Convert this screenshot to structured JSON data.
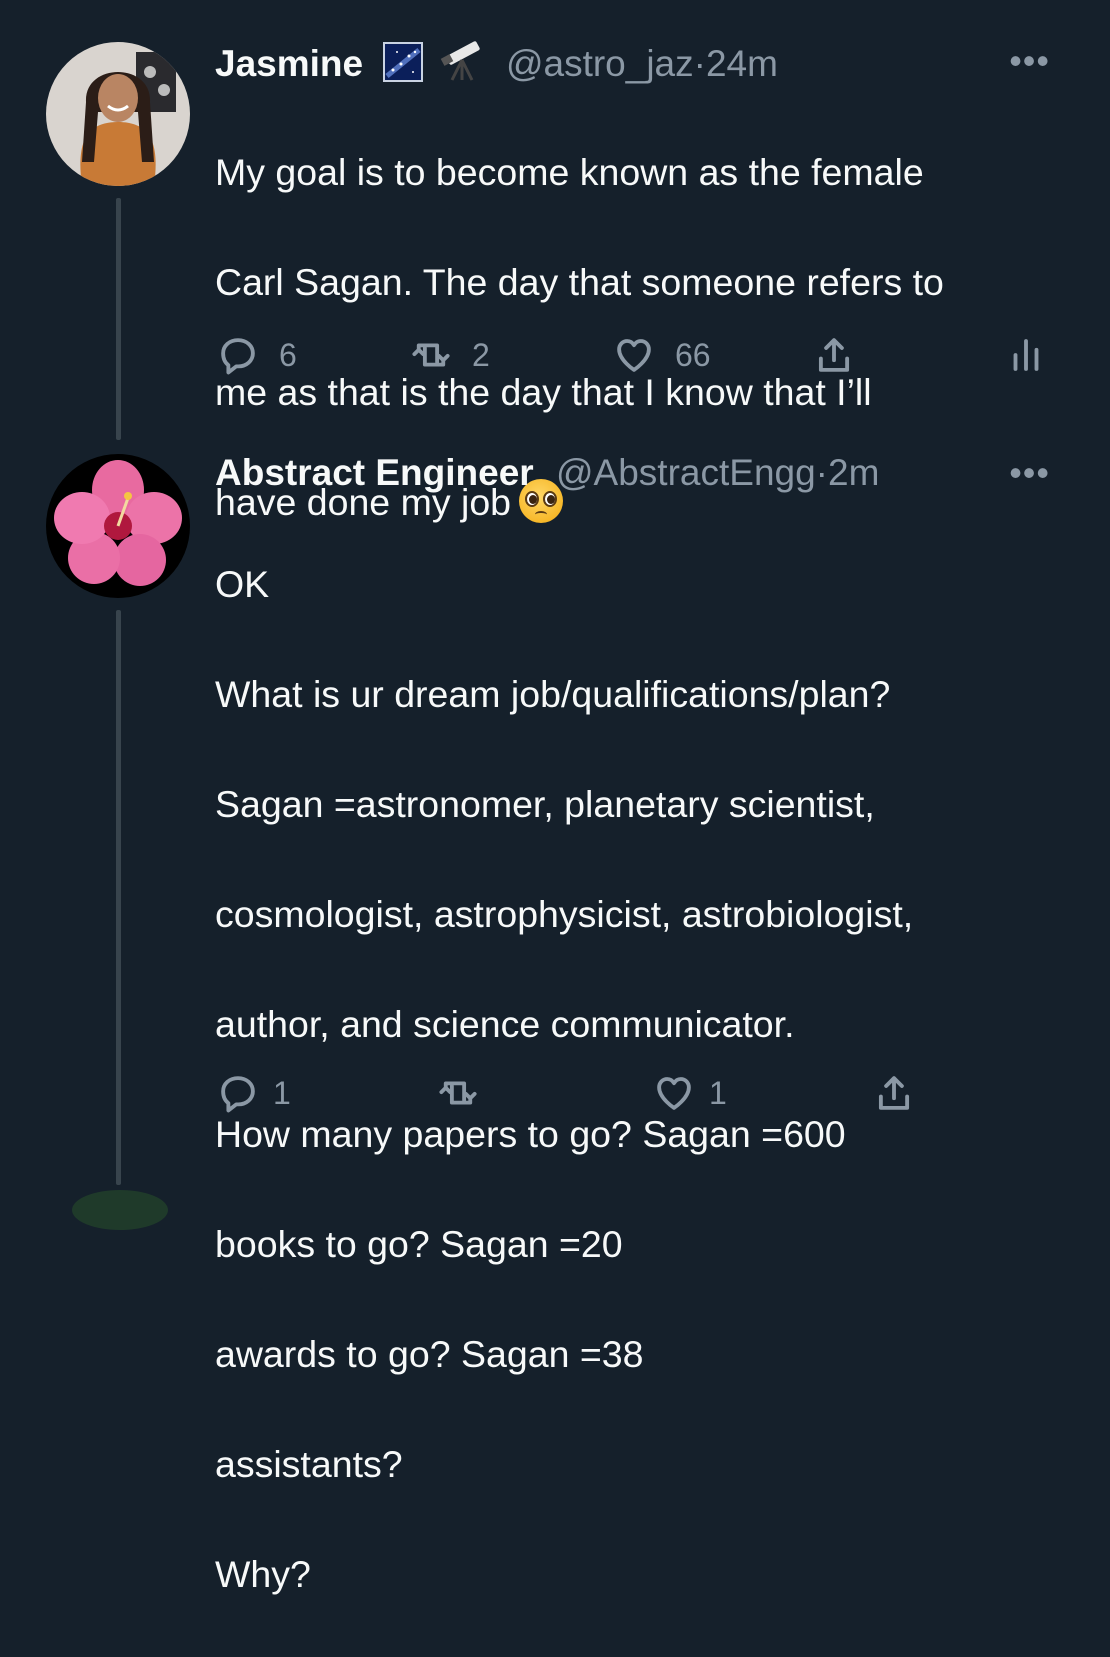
{
  "tweets": [
    {
      "name": "Jasmine",
      "badges": [
        "milky-way-emoji",
        "telescope-emoji"
      ],
      "handle": "@astro_jaz",
      "dot": "·",
      "time": "24m",
      "more": "•••",
      "lines": [
        "My goal is to become known as the female",
        "Carl Sagan. The day that someone refers to",
        "me as that is the day that I know that I’ll",
        "have done my job"
      ],
      "trailing_emoji": "pleading-face-emoji",
      "actions": {
        "replies": "6",
        "retweets": "2",
        "likes": "66"
      }
    },
    {
      "name": "Abstract Engineer",
      "handle": "@AbstractEngg",
      "dot": "·",
      "time": "2m",
      "more": "•••",
      "lines": [
        "OK",
        "What is ur dream job/qualifications/plan?",
        "Sagan =astronomer, planetary scientist,",
        "cosmologist, astrophysicist, astrobiologist,",
        "author, and science communicator.",
        "How many papers to go? Sagan =600",
        "books to go? Sagan =20",
        "awards to go? Sagan =38",
        "assistants?",
        "Why?"
      ],
      "actions": {
        "replies": "1",
        "retweets": "",
        "likes": "1"
      }
    }
  ],
  "colors": {
    "background": "#15202b",
    "text": "#f7f9f9",
    "muted": "#8b98a5",
    "thread_line": "#38444d"
  }
}
